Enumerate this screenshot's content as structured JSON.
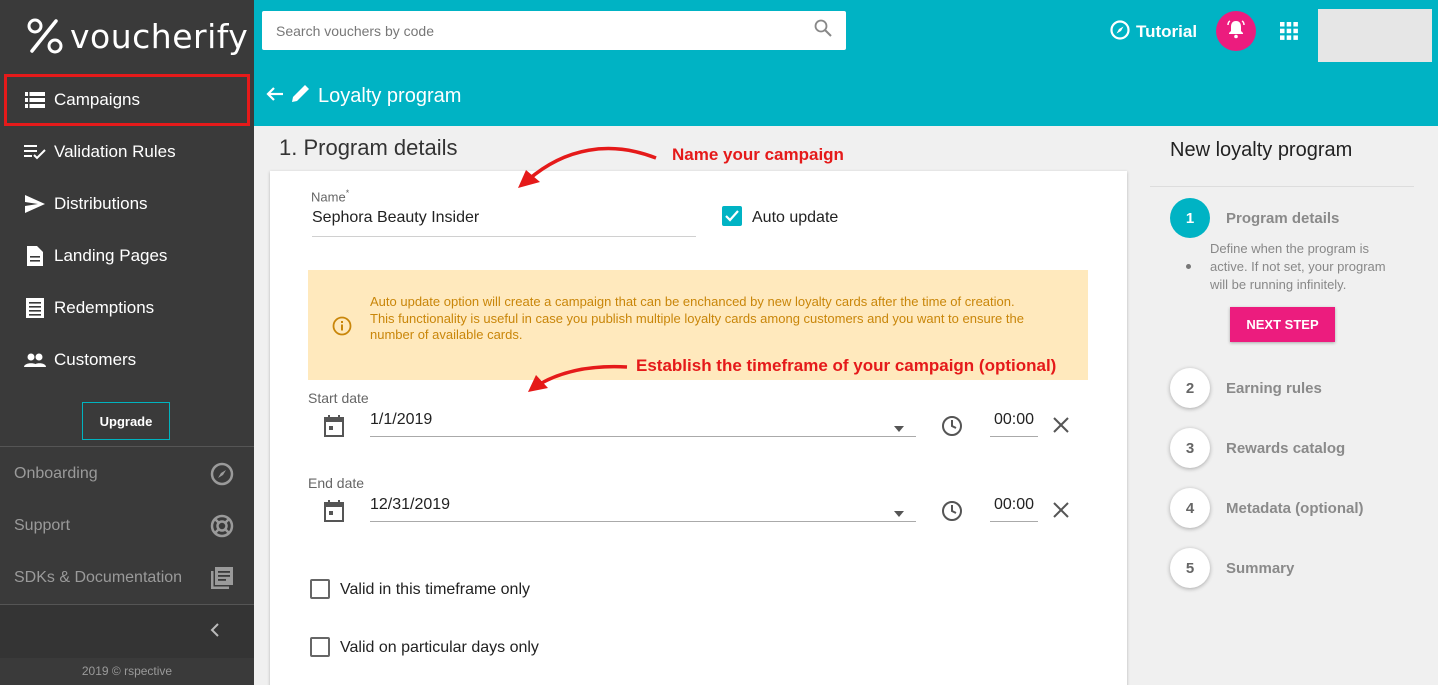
{
  "brand": {
    "logo_text": "voucherify",
    "accent": "#00b3c4",
    "pink": "#ec1c7e",
    "annotation": "#e51a1a"
  },
  "sidebar": {
    "items": [
      {
        "label": "Campaigns",
        "icon": "list-icon"
      },
      {
        "label": "Validation Rules",
        "icon": "checklist-icon"
      },
      {
        "label": "Distributions",
        "icon": "send-icon"
      },
      {
        "label": "Landing Pages",
        "icon": "document-icon"
      },
      {
        "label": "Redemptions",
        "icon": "receipt-icon"
      },
      {
        "label": "Customers",
        "icon": "people-icon"
      }
    ],
    "upgrade_label": "Upgrade",
    "links": [
      {
        "label": "Onboarding",
        "icon": "compass-icon"
      },
      {
        "label": "Support",
        "icon": "lifebuoy-icon"
      },
      {
        "label": "SDKs & Documentation",
        "icon": "library-icon"
      }
    ],
    "copyright": "2019 © rspective"
  },
  "topbar": {
    "search_placeholder": "Search vouchers by code",
    "tutorial_label": "Tutorial",
    "page_title": "Loyalty program"
  },
  "main": {
    "section_title": "1. Program details",
    "name_label": "Name",
    "name_required": "*",
    "name_value": "Sephora Beauty Insider",
    "auto_update_label": "Auto update",
    "auto_update_checked": true,
    "alert_line1": "Auto update option will create a campaign that can be enchanced by new loyalty cards after the time of creation.",
    "alert_line2": "This functionality is useful in case you publish multiple loyalty cards among customers and you want to ensure the number of available cards.",
    "start_date_label": "Start date",
    "start_date_value": "1/1/2019",
    "start_time_value": "00:00",
    "end_date_label": "End date",
    "end_date_value": "12/31/2019",
    "end_time_value": "00:00",
    "valid_timeframe_label": "Valid in this timeframe only",
    "valid_days_label": "Valid on particular days only"
  },
  "annotations": {
    "name_hint": "Name your campaign",
    "timeframe_hint": "Establish the timeframe of your campaign (optional)"
  },
  "right_panel": {
    "title": "New loyalty program",
    "steps": [
      {
        "number": "1",
        "label": "Program details"
      },
      {
        "number": "2",
        "label": "Earning rules"
      },
      {
        "number": "3",
        "label": "Rewards catalog"
      },
      {
        "number": "4",
        "label": "Metadata (optional)"
      },
      {
        "number": "5",
        "label": "Summary"
      }
    ],
    "step1_desc": "Define when the program is active. If not set, your program will be running infinitely.",
    "next_step_label": "NEXT STEP"
  }
}
